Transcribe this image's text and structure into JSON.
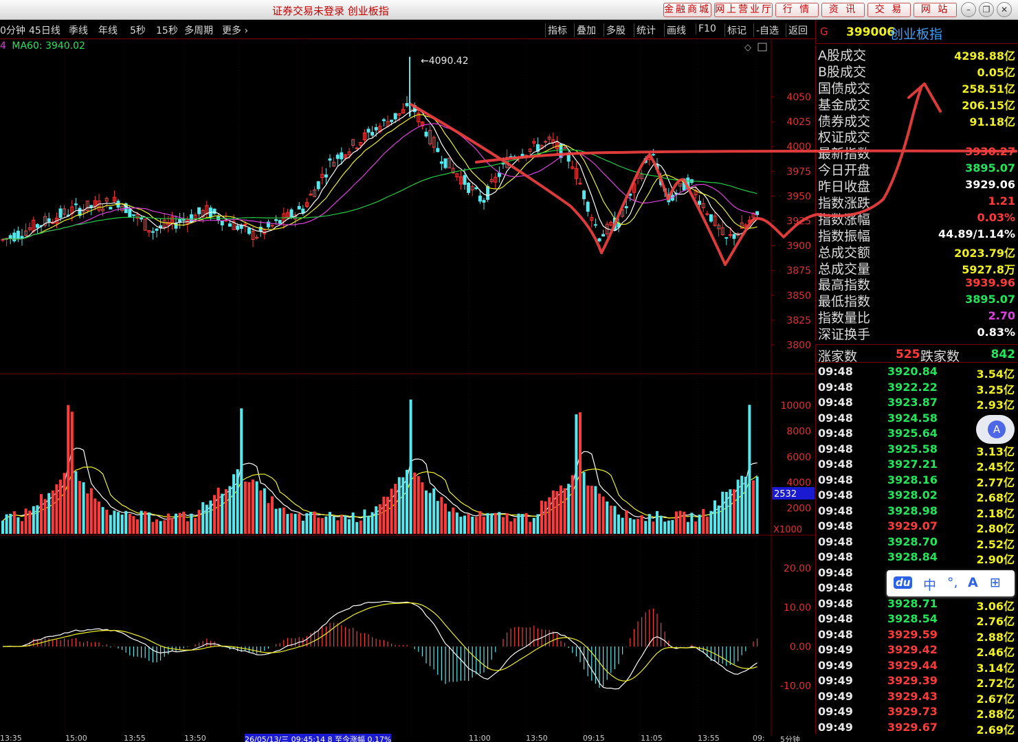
{
  "window": {
    "title": "证券交易未登录  创业板指",
    "top_buttons": [
      "金融商城",
      "网上营业厅",
      "行 情",
      "资 讯",
      "交 易",
      "网 站"
    ],
    "win_controls": [
      "–",
      "❐",
      "✕"
    ]
  },
  "toolbar": {
    "periods": [
      "0分钟",
      "45日线",
      "季线",
      "年线",
      "5秒",
      "15秒",
      "多周期",
      "更多 ›"
    ],
    "tools": [
      "指标",
      "叠加",
      "多股",
      "统计",
      "画线",
      "F10",
      "标记",
      "-自选",
      "返回"
    ]
  },
  "ma_line": {
    "prefix": "4",
    "ma60": "MA60: 3940.02"
  },
  "price_panel": {
    "peak_label": "4090.42",
    "y_ticks": [
      "4050",
      "4025",
      "4000",
      "3975",
      "3950",
      "3925",
      "3900",
      "3875",
      "3850",
      "3825",
      "3800"
    ]
  },
  "volume_panel": {
    "y_ticks": [
      "10000",
      "8000",
      "6000",
      "4000",
      "2000"
    ],
    "current": "2532",
    "unit": "X1000"
  },
  "macd_panel": {
    "y_ticks": [
      "20.00",
      "10.00",
      "0.00",
      "-10.00"
    ]
  },
  "bottom_axis": {
    "labels": [
      "13:35",
      "15:00",
      "13:55",
      "13:50",
      "26/05/13/三  09:45:14 8  至今涨幅  0.17%",
      "11:00",
      "13:50",
      "09:15",
      "11:05",
      "13:55",
      "09:"
    ],
    "period": "5分钟"
  },
  "quote": {
    "g": "G",
    "code": "399006",
    "name": "创业板指",
    "stats": [
      {
        "label": "A股成交",
        "value": "4298.88亿",
        "color": "#f0f020"
      },
      {
        "label": "B股成交",
        "value": "0.05亿",
        "color": "#f0f020"
      },
      {
        "label": "国债成交",
        "value": "258.51亿",
        "color": "#f0f020"
      },
      {
        "label": "基金成交",
        "value": "206.15亿",
        "color": "#f0f020"
      },
      {
        "label": "债券成交",
        "value": "91.18亿",
        "color": "#f0f020"
      },
      {
        "label": "权证成交",
        "value": "",
        "color": "#f0f020"
      },
      {
        "label": "最新指数",
        "value": "3930.27",
        "color": "#ff3a3a"
      },
      {
        "label": "今日开盘",
        "value": "3895.07",
        "color": "#22e65a"
      },
      {
        "label": "昨日收盘",
        "value": "3929.06",
        "color": "#ffffff"
      },
      {
        "label": "指数涨跌",
        "value": "1.21",
        "color": "#ff3a3a"
      },
      {
        "label": "指数涨幅",
        "value": "0.03%",
        "color": "#ff3a3a"
      },
      {
        "label": "指数振幅",
        "value": "44.89/1.14%",
        "color": "#ffffff"
      },
      {
        "label": "总成交额",
        "value": "2023.79亿",
        "color": "#f0f020"
      },
      {
        "label": "总成交量",
        "value": "5927.8万",
        "color": "#f0f020"
      },
      {
        "label": "最高指数",
        "value": "3939.96",
        "color": "#ff3a3a"
      },
      {
        "label": "最低指数",
        "value": "3895.07",
        "color": "#22e65a"
      },
      {
        "label": "指数量比",
        "value": "2.70",
        "color": "#e040e0"
      },
      {
        "label": "深证换手",
        "value": "0.83%",
        "color": "#ffffff"
      }
    ],
    "up_label": "涨家数",
    "up_count": "525",
    "down_label": "跌家数",
    "down_count": "842"
  },
  "ticks": [
    {
      "time": "09:48",
      "price": "3920.84",
      "amount": "3.54亿",
      "color": "#22e65a"
    },
    {
      "time": "09:48",
      "price": "3922.22",
      "amount": "3.25亿",
      "color": "#22e65a"
    },
    {
      "time": "09:48",
      "price": "3923.87",
      "amount": "2.93亿",
      "color": "#22e65a"
    },
    {
      "time": "09:48",
      "price": "3924.58",
      "amount": "",
      "color": "#22e65a"
    },
    {
      "time": "09:48",
      "price": "3925.64",
      "amount": "",
      "color": "#22e65a"
    },
    {
      "time": "09:48",
      "price": "3925.58",
      "amount": "3.13亿",
      "color": "#22e65a"
    },
    {
      "time": "09:48",
      "price": "3927.21",
      "amount": "2.45亿",
      "color": "#22e65a"
    },
    {
      "time": "09:48",
      "price": "3928.16",
      "amount": "2.77亿",
      "color": "#22e65a"
    },
    {
      "time": "09:48",
      "price": "3928.02",
      "amount": "2.68亿",
      "color": "#22e65a"
    },
    {
      "time": "09:48",
      "price": "3928.98",
      "amount": "2.18亿",
      "color": "#22e65a"
    },
    {
      "time": "09:48",
      "price": "3929.07",
      "amount": "2.80亿",
      "color": "#ff3a3a"
    },
    {
      "time": "09:48",
      "price": "3928.70",
      "amount": "2.52亿",
      "color": "#22e65a"
    },
    {
      "time": "09:48",
      "price": "3928.84",
      "amount": "2.90亿",
      "color": "#22e65a"
    },
    {
      "time": "09:48",
      "price": "",
      "amount": "",
      "color": "#22e65a"
    },
    {
      "time": "09:48",
      "price": "",
      "amount": "",
      "color": "#22e65a"
    },
    {
      "time": "09:48",
      "price": "3928.71",
      "amount": "3.06亿",
      "color": "#22e65a"
    },
    {
      "time": "09:48",
      "price": "3928.54",
      "amount": "2.76亿",
      "color": "#22e65a"
    },
    {
      "time": "09:48",
      "price": "3929.59",
      "amount": "2.88亿",
      "color": "#ff3a3a"
    },
    {
      "time": "09:49",
      "price": "3929.42",
      "amount": "2.46亿",
      "color": "#ff3a3a"
    },
    {
      "time": "09:49",
      "price": "3929.44",
      "amount": "3.14亿",
      "color": "#ff3a3a"
    },
    {
      "time": "09:49",
      "price": "3929.39",
      "amount": "2.72亿",
      "color": "#ff3a3a"
    },
    {
      "time": "09:49",
      "price": "3929.43",
      "amount": "2.67亿",
      "color": "#ff3a3a"
    },
    {
      "time": "09:49",
      "price": "3929.73",
      "amount": "2.88亿",
      "color": "#ff3a3a"
    },
    {
      "time": "09:49",
      "price": "3929.67",
      "amount": "2.69亿",
      "color": "#ff3a3a"
    }
  ],
  "overlays": {
    "fab_icon": "A",
    "ime_items": [
      "du",
      "中",
      "°,",
      "A",
      "⊞"
    ]
  },
  "colors": {
    "up": "#ff3a3a",
    "down": "#55e8ee",
    "ma_white": "#ffffff",
    "ma_yellow": "#f0f020",
    "ma_magenta": "#e040e0",
    "ma_green": "#22cc44",
    "annotation": "#f04040",
    "grid": "#7a0000"
  }
}
